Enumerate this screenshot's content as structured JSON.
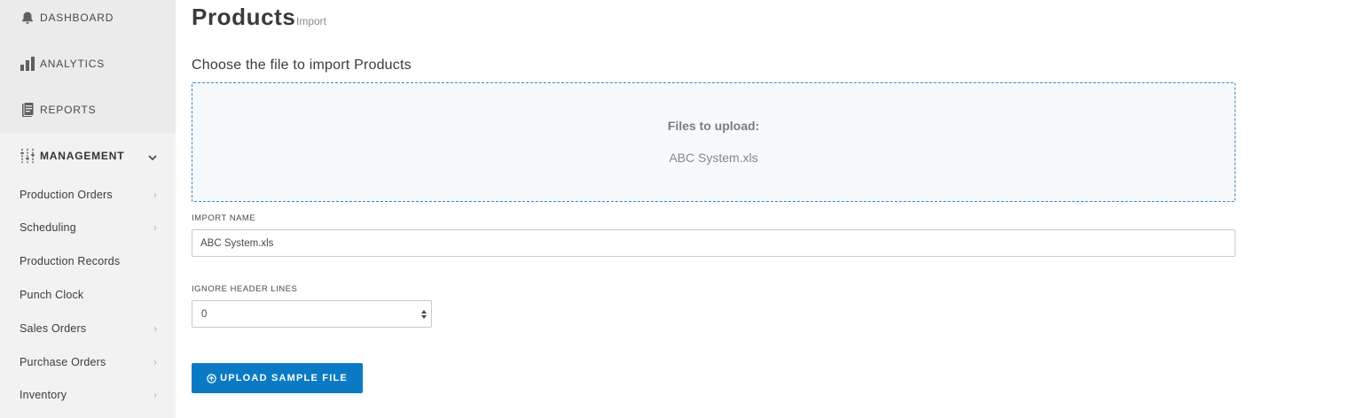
{
  "sidebar": {
    "main_items": [
      {
        "label": "DASHBOARD",
        "icon": "bell-icon"
      },
      {
        "label": "ANALYTICS",
        "icon": "bar-chart-icon"
      },
      {
        "label": "REPORTS",
        "icon": "report-icon"
      }
    ],
    "management": {
      "label": "MANAGEMENT",
      "icon": "sliders-icon",
      "expanded": true
    },
    "sub_items": [
      {
        "label": "Production Orders",
        "has_arrow": true
      },
      {
        "label": "Scheduling",
        "has_arrow": true
      },
      {
        "label": "Production Records",
        "has_arrow": false
      },
      {
        "label": "Punch Clock",
        "has_arrow": false
      },
      {
        "label": "Sales Orders",
        "has_arrow": true
      },
      {
        "label": "Purchase Orders",
        "has_arrow": true
      },
      {
        "label": "Inventory",
        "has_arrow": true
      }
    ]
  },
  "header": {
    "title": "Products",
    "subtitle": "Import"
  },
  "main": {
    "section_title": "Choose the file to import Products",
    "dropzone": {
      "title": "Files to upload:",
      "file_name": "ABC System.xls"
    },
    "import_name": {
      "label": "IMPORT NAME",
      "value": "ABC System.xls"
    },
    "ignore_header_lines": {
      "label": "IGNORE HEADER LINES",
      "value": "0"
    },
    "upload_button": {
      "label": "UPLOAD SAMPLE FILE",
      "icon": "upload-circle-icon"
    }
  },
  "colors": {
    "accent": "#0a7ac4",
    "sidebar_bg": "#f2f2f2",
    "dropzone_border": "#3a86c4"
  }
}
